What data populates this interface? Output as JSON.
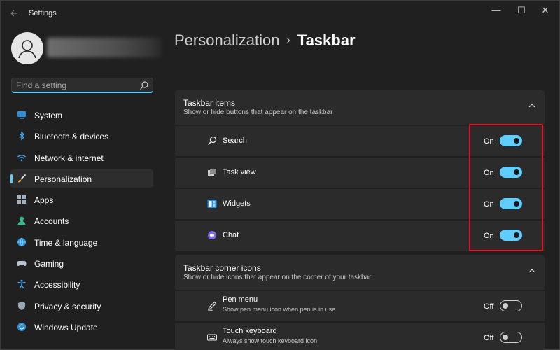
{
  "window": {
    "title": "Settings",
    "controls": {
      "minimize": "—",
      "maximize": "☐",
      "close": "✕"
    }
  },
  "search": {
    "placeholder": "Find a setting",
    "value": ""
  },
  "sidebar": {
    "items": [
      {
        "label": "System",
        "icon": "monitor-icon"
      },
      {
        "label": "Bluetooth & devices",
        "icon": "bluetooth-icon"
      },
      {
        "label": "Network & internet",
        "icon": "wifi-icon"
      },
      {
        "label": "Personalization",
        "icon": "brush-icon",
        "selected": true
      },
      {
        "label": "Apps",
        "icon": "apps-icon"
      },
      {
        "label": "Accounts",
        "icon": "person-icon"
      },
      {
        "label": "Time & language",
        "icon": "globe-clock-icon"
      },
      {
        "label": "Gaming",
        "icon": "gamepad-icon"
      },
      {
        "label": "Accessibility",
        "icon": "accessibility-icon"
      },
      {
        "label": "Privacy & security",
        "icon": "shield-icon"
      },
      {
        "label": "Windows Update",
        "icon": "update-icon"
      }
    ]
  },
  "header": {
    "parent": "Personalization",
    "separator": "›",
    "current": "Taskbar"
  },
  "sections": {
    "taskbar_items": {
      "title": "Taskbar items",
      "subtitle": "Show or hide buttons that appear on the taskbar",
      "rows": [
        {
          "label": "Search",
          "state": "On",
          "icon": "search-icon"
        },
        {
          "label": "Task view",
          "state": "On",
          "icon": "task-view-icon"
        },
        {
          "label": "Widgets",
          "state": "On",
          "icon": "widgets-icon"
        },
        {
          "label": "Chat",
          "state": "On",
          "icon": "chat-icon"
        }
      ]
    },
    "corner_icons": {
      "title": "Taskbar corner icons",
      "subtitle": "Show or hide icons that appear on the corner of your taskbar",
      "rows": [
        {
          "label": "Pen menu",
          "sub": "Show pen menu icon when pen is in use",
          "state": "Off",
          "icon": "pen-icon"
        },
        {
          "label": "Touch keyboard",
          "sub": "Always show touch keyboard icon",
          "state": "Off",
          "icon": "keyboard-icon"
        }
      ]
    }
  },
  "colors": {
    "accent": "#60cdff",
    "background": "#202020",
    "card": "#2b2b2b",
    "highlight": "#e81123"
  }
}
